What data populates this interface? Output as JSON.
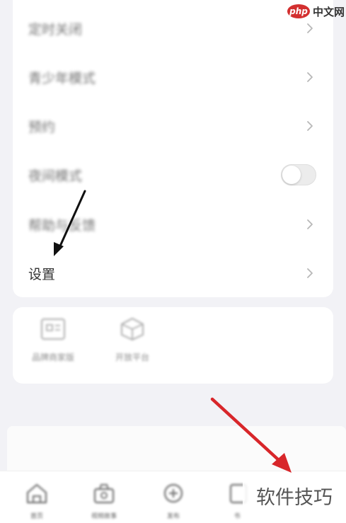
{
  "menu": {
    "items": [
      {
        "label": "定时关闭",
        "control": "chevron-right-icon"
      },
      {
        "label": "青少年模式",
        "control": "chevron-right-icon"
      },
      {
        "label": "预约",
        "control": "chevron-right-icon"
      },
      {
        "label": "夜间模式",
        "control": "toggle",
        "toggle_on": false
      },
      {
        "label": "帮助与反馈",
        "control": "chevron-right-icon"
      },
      {
        "label": "设置",
        "control": "chevron-right-icon"
      }
    ]
  },
  "tools": {
    "items": [
      {
        "label": "品牌商家版",
        "icon": "store-icon"
      },
      {
        "label": "开放平台",
        "icon": "cube-icon"
      }
    ]
  },
  "tabbar": {
    "items": [
      {
        "label": "首页",
        "icon": "home-icon"
      },
      {
        "label": "视频故事",
        "icon": "bag-icon"
      },
      {
        "label": "发布",
        "icon": "plus-circle-icon"
      },
      {
        "label": "书",
        "icon": "book-icon"
      }
    ]
  },
  "watermarks": {
    "php_badge": "php",
    "php_text": "中文网",
    "site": "软件技巧"
  },
  "colors": {
    "annotation_black": "#111111",
    "annotation_red": "#d8262a",
    "background": "#f2f2f6",
    "card": "#ffffff"
  }
}
